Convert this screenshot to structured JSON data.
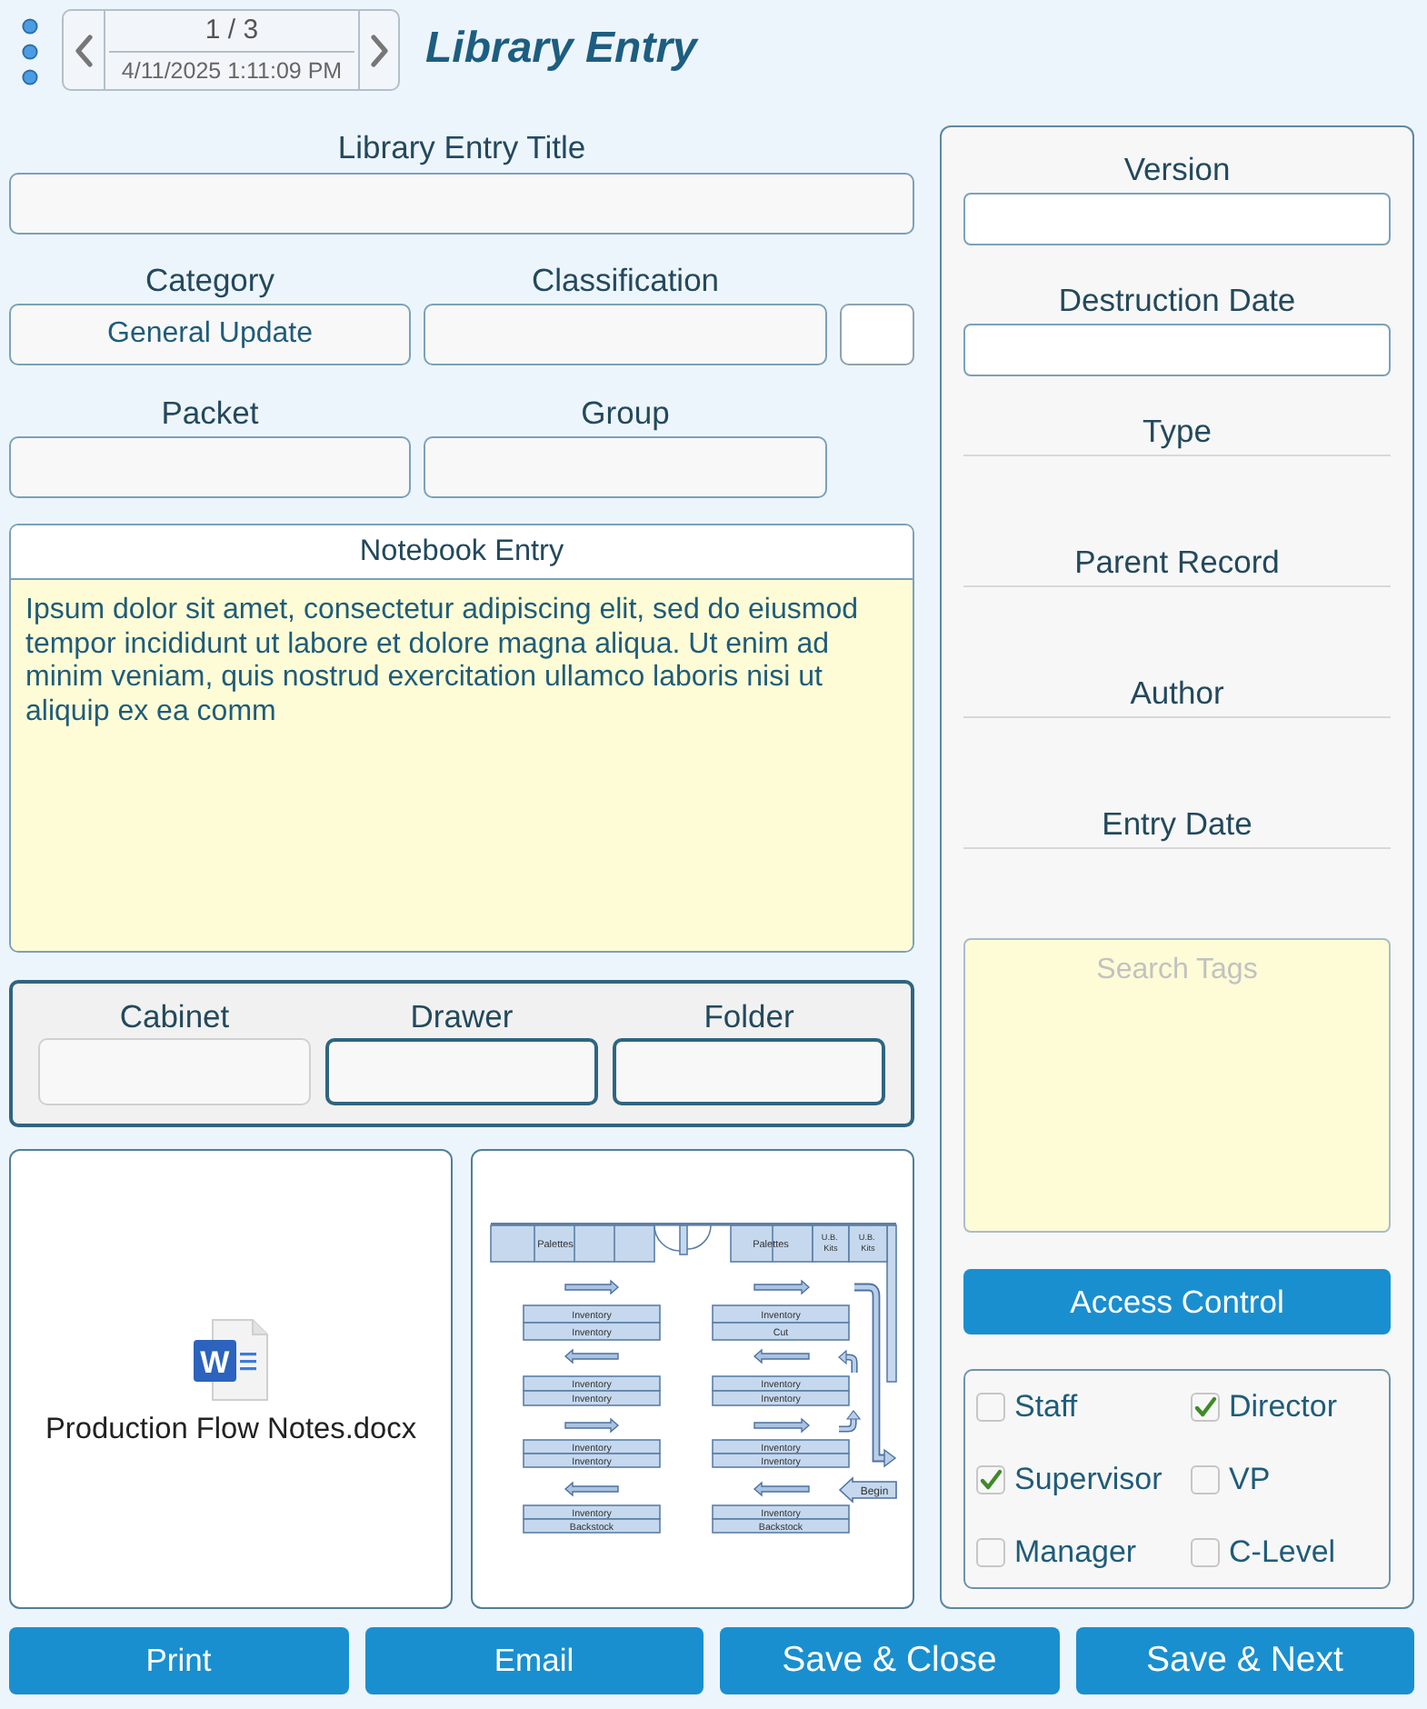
{
  "header": {
    "record_position": "1 / 3",
    "record_timestamp": "4/11/2025 1:11:09 PM",
    "title": "Library Entry"
  },
  "form": {
    "title": {
      "label": "Library Entry Title"
    },
    "category": {
      "label": "Category",
      "value": "General Update"
    },
    "classification": {
      "label": "Classification"
    },
    "packet": {
      "label": "Packet"
    },
    "group": {
      "label": "Group"
    }
  },
  "notebook": {
    "label": "Notebook Entry",
    "value": "Ipsum dolor sit amet, consectetur adipiscing elit, sed do eiusmod tempor incididunt ut labore et dolore magna aliqua. Ut enim ad minim veniam, quis nostrud exercitation ullamco laboris nisi ut aliquip ex ea comm"
  },
  "storage": [
    {
      "label": "Cabinet",
      "disabled": true
    },
    {
      "label": "Drawer",
      "disabled": false
    },
    {
      "label": "Folder",
      "disabled": false
    }
  ],
  "attachments": [
    {
      "kind": "document",
      "icon_letter": "W",
      "file_name": "Production Flow Notes.docx"
    },
    {
      "kind": "floor_plan",
      "pallet_bays": [
        {
          "label": "Palettes"
        },
        {
          "label": "Palettes"
        }
      ],
      "kit_bays": [
        {
          "label": "U.B. Kits"
        },
        {
          "label": "U.B. Kits"
        }
      ],
      "racks": [
        {
          "shelves": [
            "Inventory",
            "Inventory"
          ]
        },
        {
          "shelves": [
            "Inventory",
            "Cut"
          ]
        },
        {
          "shelves": [
            "Inventory",
            "Inventory"
          ]
        },
        {
          "shelves": [
            "Inventory",
            "Inventory"
          ]
        },
        {
          "shelves": [
            "Inventory",
            "Inventory"
          ]
        },
        {
          "shelves": [
            "Inventory",
            "Inventory"
          ]
        },
        {
          "shelves": [
            "Inventory",
            "Backstock"
          ]
        },
        {
          "shelves": [
            "Inventory",
            "Backstock"
          ]
        }
      ],
      "start_label": "Begin"
    }
  ],
  "side_panel": {
    "fields": [
      {
        "kind": "input",
        "label": "Version"
      },
      {
        "kind": "input",
        "label": "Destruction Date"
      },
      {
        "kind": "display",
        "label": "Type"
      },
      {
        "kind": "display",
        "label": "Parent Record"
      },
      {
        "kind": "display",
        "label": "Author"
      },
      {
        "kind": "display",
        "label": "Entry Date"
      }
    ],
    "search_tags": {
      "placeholder": "Search Tags"
    },
    "access_button": "Access Control",
    "roles": [
      {
        "label": "Staff",
        "checked": false
      },
      {
        "label": "Director",
        "checked": true
      },
      {
        "label": "Supervisor",
        "checked": true
      },
      {
        "label": "VP",
        "checked": false
      },
      {
        "label": "Manager",
        "checked": false
      },
      {
        "label": "C-Level",
        "checked": false
      }
    ]
  },
  "buttons": [
    {
      "label": "Print",
      "kind": "output"
    },
    {
      "label": "Email",
      "kind": "output"
    },
    {
      "label": "Save & Close",
      "kind": "save"
    },
    {
      "label": "Save & Next",
      "kind": "save"
    }
  ]
}
